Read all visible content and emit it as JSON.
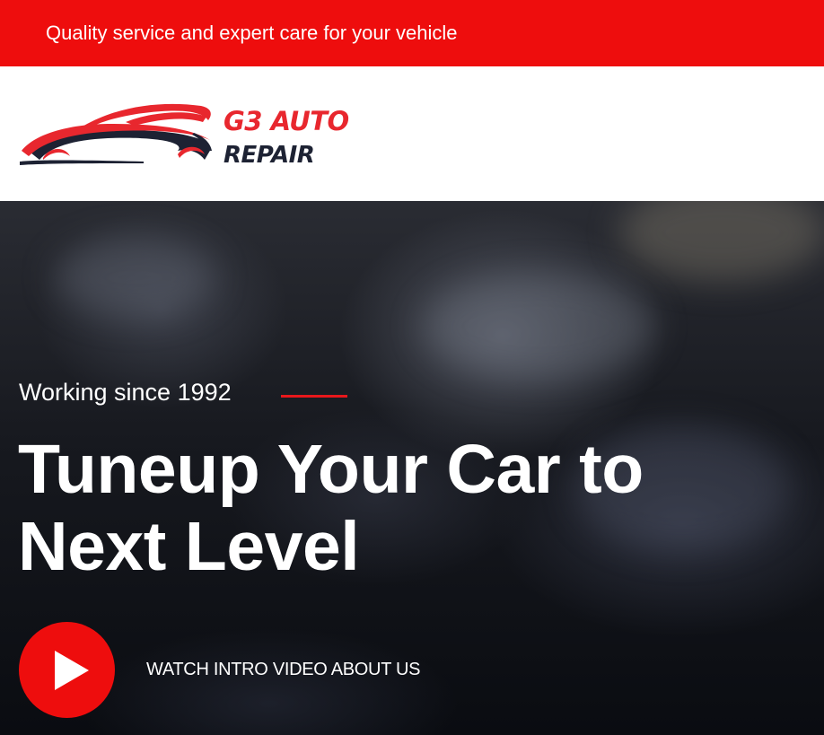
{
  "top_bar": {
    "message": "Quality service and expert care for your vehicle"
  },
  "header": {
    "logo": {
      "line1": "G3 AUTO",
      "line2": "REPAIR"
    }
  },
  "hero": {
    "tagline": "Working since 1992",
    "headline_line1": "Tuneup Your Car to",
    "headline_line2": "Next Level",
    "video_link_label": "WATCH INTRO VIDEO ABOUT US",
    "play_icon": "play-icon"
  },
  "colors": {
    "accent": "#ee0d0d",
    "logo_red": "#e8272e",
    "logo_navy": "#1d2233",
    "text_light": "#ffffff"
  }
}
